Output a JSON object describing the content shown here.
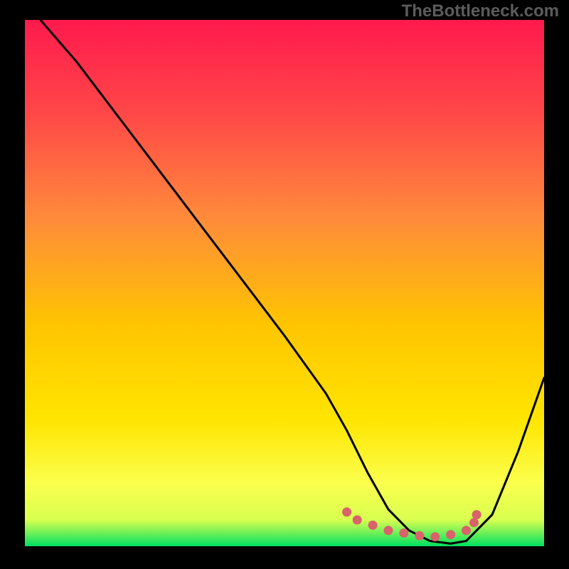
{
  "watermark": "TheBottleneck.com",
  "chart_data": {
    "type": "line",
    "title": "",
    "xlabel": "",
    "ylabel": "",
    "xlim": [
      0,
      100
    ],
    "ylim": [
      0,
      100
    ],
    "background_gradient": {
      "top": "#ff1a4d",
      "upper_mid": "#ff8040",
      "mid": "#ffd000",
      "lower_mid": "#ffff66",
      "bottom": "#00e060"
    },
    "series": [
      {
        "name": "bottleneck-curve",
        "x": [
          3,
          10,
          20,
          30,
          40,
          50,
          58,
          62,
          66,
          70,
          74,
          78,
          82,
          85,
          90,
          95,
          100
        ],
        "y": [
          100,
          92,
          79,
          66,
          53,
          40,
          29,
          22,
          14,
          7,
          3,
          1,
          0.5,
          1,
          6,
          18,
          32
        ]
      }
    ],
    "markers": {
      "name": "bottleneck-optimal-zone",
      "color": "#d9626b",
      "points": [
        {
          "x": 62,
          "y": 6.5
        },
        {
          "x": 64,
          "y": 5
        },
        {
          "x": 67,
          "y": 4
        },
        {
          "x": 70,
          "y": 3
        },
        {
          "x": 73,
          "y": 2.5
        },
        {
          "x": 76,
          "y": 2
        },
        {
          "x": 79,
          "y": 1.8
        },
        {
          "x": 82,
          "y": 2.2
        },
        {
          "x": 85,
          "y": 3
        },
        {
          "x": 86.5,
          "y": 4.5
        },
        {
          "x": 87,
          "y": 6
        }
      ]
    }
  }
}
